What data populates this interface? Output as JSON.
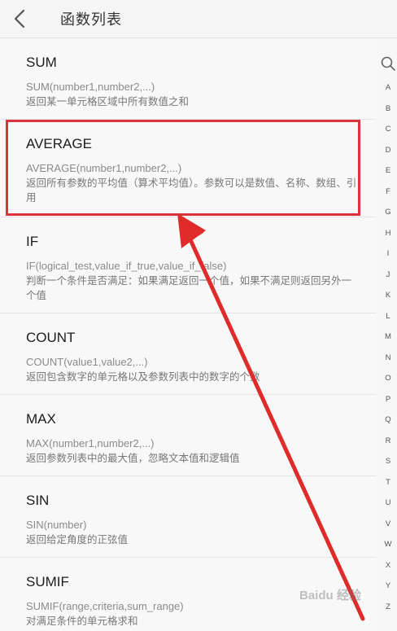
{
  "header": {
    "title": "函数列表"
  },
  "functions": [
    {
      "name": "SUM",
      "syntax": "SUM(number1,number2,...)",
      "desc": "返回某一单元格区域中所有数值之和"
    },
    {
      "name": "AVERAGE",
      "syntax": "AVERAGE(number1,number2,...)",
      "desc": "返回所有参数的平均值（算术平均值）。参数可以是数值、名称、数组、引用"
    },
    {
      "name": "IF",
      "syntax": "IF(logical_test,value_if_true,value_if_false)",
      "desc": "判断一个条件是否满足：如果满足返回一个值，如果不满足则返回另外一个值"
    },
    {
      "name": "COUNT",
      "syntax": "COUNT(value1,value2,...)",
      "desc": "返回包含数字的单元格以及参数列表中的数字的个数"
    },
    {
      "name": "MAX",
      "syntax": "MAX(number1,number2,...)",
      "desc": "返回参数列表中的最大值，忽略文本值和逻辑值"
    },
    {
      "name": "SIN",
      "syntax": "SIN(number)",
      "desc": "返回给定角度的正弦值"
    },
    {
      "name": "SUMIF",
      "syntax": "SUMIF(range,criteria,sum_range)",
      "desc": "对满足条件的单元格求和"
    }
  ],
  "alphabet": [
    "A",
    "B",
    "C",
    "D",
    "E",
    "F",
    "G",
    "H",
    "I",
    "J",
    "K",
    "L",
    "M",
    "N",
    "O",
    "P",
    "Q",
    "R",
    "S",
    "T",
    "U",
    "V",
    "W",
    "X",
    "Y",
    "Z"
  ],
  "watermark": "Baidu 经验",
  "colors": {
    "highlight": "#d9333b",
    "arrow": "#e02b2b"
  }
}
